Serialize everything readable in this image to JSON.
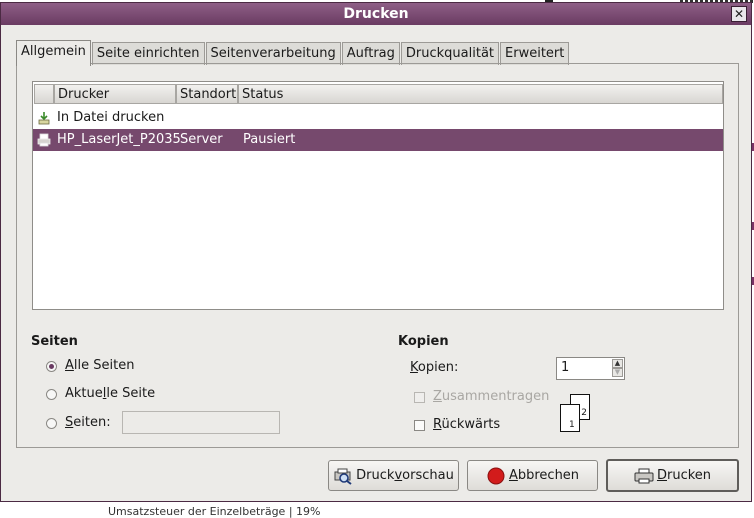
{
  "window": {
    "title": "Drucken",
    "close_label": "✕"
  },
  "tabs": [
    {
      "label": "Allgemein",
      "active": true
    },
    {
      "label": "Seite einrichten"
    },
    {
      "label": "Seitenverarbeitung"
    },
    {
      "label": "Auftrag"
    },
    {
      "label": "Druckqualität"
    },
    {
      "label": "Erweitert"
    }
  ],
  "printer_list": {
    "columns": {
      "printer": "Drucker",
      "location": "Standort",
      "status": "Status"
    },
    "rows": [
      {
        "name": "In Datei drucken",
        "location": "",
        "status": "",
        "icon": "file-icon"
      },
      {
        "name": "HP_LaserJet_P2035",
        "location": "Server",
        "status": "Pausiert",
        "icon": "printer-icon",
        "selected": true
      }
    ]
  },
  "pages": {
    "title": "Seiten",
    "all": {
      "pre": "",
      "u": "A",
      "post": "lle Seiten"
    },
    "current": {
      "pre": "Aktue",
      "u": "l",
      "post": "le Seite"
    },
    "range": {
      "pre": "",
      "u": "S",
      "post": "eiten:"
    },
    "range_value": "",
    "selected": "all"
  },
  "copies": {
    "title": "Kopien",
    "label": {
      "pre": "",
      "u": "K",
      "post": "opien:"
    },
    "value": "1",
    "collate": {
      "pre": "",
      "u": "Z",
      "post": "usammentragen"
    },
    "reverse": {
      "pre": "",
      "u": "R",
      "post": "ückwärts"
    },
    "collate_checked": false,
    "reverse_checked": false,
    "page_icon_front": "1",
    "page_icon_back": "2"
  },
  "buttons": {
    "preview": {
      "pre": "Druck",
      "u": "v",
      "post": "orschau"
    },
    "cancel": {
      "pre": "",
      "u": "A",
      "post": "bbrechen"
    },
    "print": {
      "pre": "",
      "u": "D",
      "post": "rucken"
    }
  },
  "background": {
    "fragment_bottom": "Umsatzsteuer der Einzelbeträge | 19%"
  },
  "colors": {
    "titlebar": "#6a3b62",
    "selection": "#76496d",
    "cancel_icon": "#d21b1b"
  }
}
